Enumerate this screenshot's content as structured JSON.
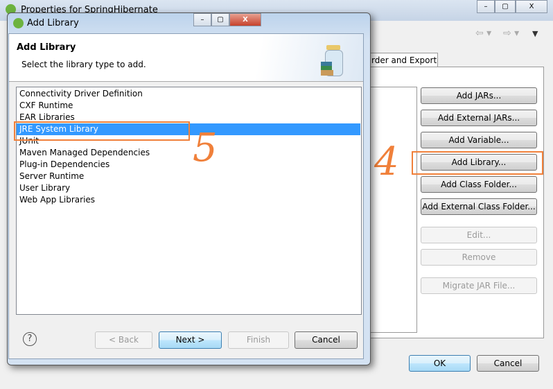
{
  "back_window": {
    "title": "Properties for SpringHibernate",
    "tab": "rder and Export",
    "buttons": [
      "Add JARs...",
      "Add External JARs...",
      "Add Variable...",
      "Add Library...",
      "Add Class Folder...",
      "Add External Class Folder..."
    ],
    "disabled_buttons": [
      "Edit...",
      "Remove",
      "Migrate JAR File..."
    ],
    "ok": "OK",
    "cancel": "Cancel"
  },
  "dialog": {
    "title": "Add Library",
    "header_title": "Add Library",
    "header_desc": "Select the library type to add.",
    "items": [
      "Connectivity Driver Definition",
      "CXF Runtime",
      "EAR Libraries",
      "JRE System Library",
      "JUnit",
      "Maven Managed Dependencies",
      "Plug-in Dependencies",
      "Server Runtime",
      "User Library",
      "Web App Libraries"
    ],
    "selected_index": 3,
    "back": "< Back",
    "next": "Next >",
    "finish": "Finish",
    "cancel": "Cancel",
    "help": "?"
  },
  "annotations": {
    "step4": "4",
    "step5": "5",
    "color": "#f0803a"
  },
  "colors": {
    "selection": "#3399ff",
    "accent": "#f0803a"
  }
}
